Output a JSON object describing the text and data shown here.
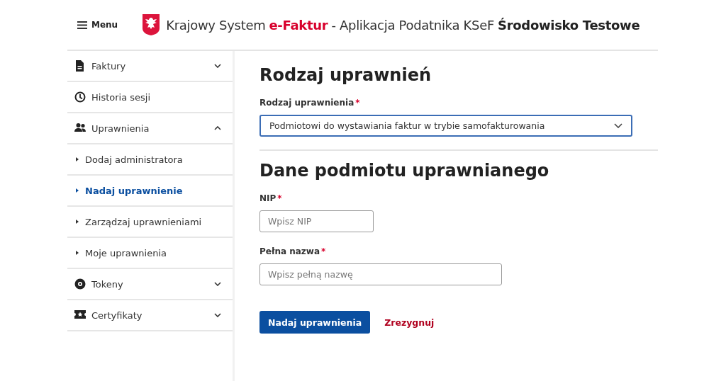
{
  "header": {
    "menu_label": "Menu",
    "title": [
      {
        "text": "Krajowy System",
        "kind": "plain"
      },
      {
        "text": "e-Faktur",
        "kind": "brand"
      },
      {
        "text": "- Aplikacja Podatnika KSeF",
        "kind": "plain"
      },
      {
        "text": "Środowisko Testowe",
        "kind": "strong"
      }
    ]
  },
  "sidebar": {
    "items": [
      {
        "label": "Faktury",
        "expanded": false
      },
      {
        "label": "Historia sesji"
      },
      {
        "label": "Uprawnienia",
        "expanded": true,
        "children": [
          {
            "label": "Dodaj administratora",
            "selected": false
          },
          {
            "label": "Nadaj uprawnienie",
            "selected": true
          },
          {
            "label": "Zarządzaj uprawnieniami",
            "selected": false
          },
          {
            "label": "Moje uprawnienia",
            "selected": false
          }
        ]
      },
      {
        "label": "Tokeny",
        "expanded": false
      },
      {
        "label": "Certyfikaty",
        "expanded": false
      }
    ]
  },
  "main": {
    "sections": [
      {
        "heading": "Rodzaj uprawnień",
        "fields": [
          {
            "kind": "select",
            "label": "Rodzaj uprawnienia",
            "mark": "*",
            "value": "Podmiotowi do wystawiania faktur w trybie samofakturowania"
          }
        ]
      },
      {
        "heading": "Dane podmiotu uprawnianego",
        "fields": [
          {
            "kind": "text",
            "label": "NIP",
            "mark": "*",
            "placeholder": "Wpisz NIP"
          },
          {
            "kind": "text",
            "label": "Pełna nazwa",
            "mark": "*",
            "placeholder": "Wpisz pełną nazwę"
          }
        ]
      }
    ],
    "buttons": [
      {
        "label": "Nadaj uprawnienia",
        "kind": "primary"
      },
      {
        "label": "Zrezygnuj",
        "kind": "link"
      }
    ]
  }
}
